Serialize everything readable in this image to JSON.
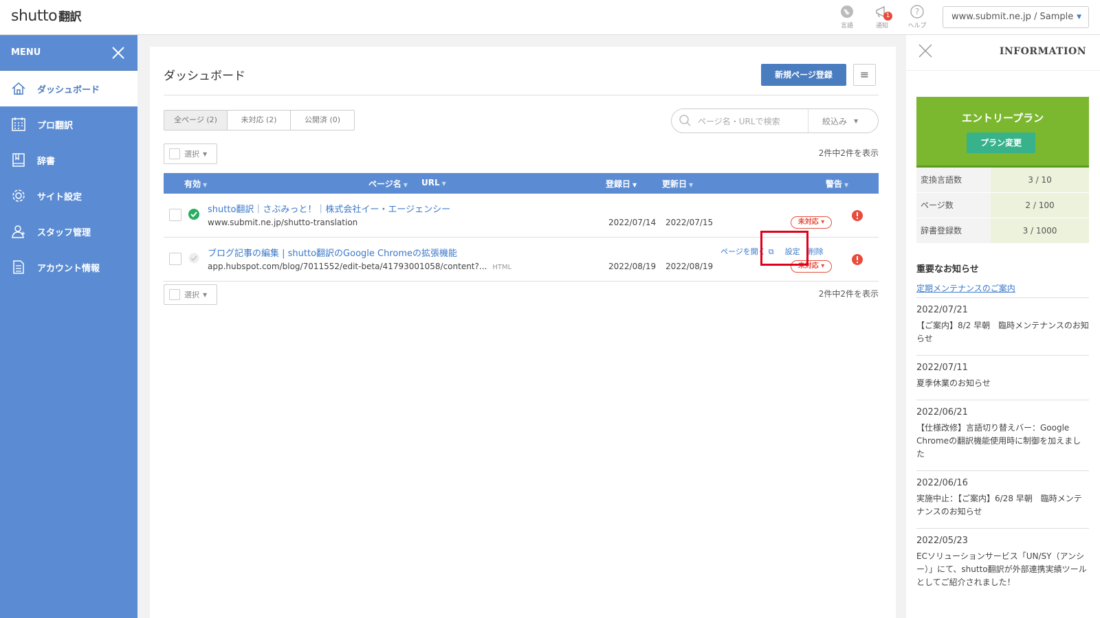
{
  "app": {
    "logo_main": "shutto",
    "logo_sub": "翻訳"
  },
  "topbar": {
    "icons": [
      {
        "name": "language",
        "caption": "言語"
      },
      {
        "name": "notifications",
        "caption": "通知",
        "badge": "1"
      },
      {
        "name": "help",
        "caption": "ヘルプ"
      }
    ],
    "site_select": "www.submit.ne.jp / Sample"
  },
  "sidebar": {
    "menu_label": "MENU",
    "items": [
      {
        "label": "ダッシュボード",
        "icon": "home-icon",
        "active": true
      },
      {
        "label": "プロ翻訳",
        "icon": "calendar-icon"
      },
      {
        "label": "辞書",
        "icon": "book-icon"
      },
      {
        "label": "サイト設定",
        "icon": "gear-icon"
      },
      {
        "label": "スタッフ管理",
        "icon": "staff-icon"
      },
      {
        "label": "アカウント情報",
        "icon": "document-icon"
      }
    ]
  },
  "main": {
    "title": "ダッシュボード",
    "new_page_button": "新規ページ登録",
    "filter_tabs": [
      "全ページ (2)",
      "未対応 (2)",
      "公開済 (0)"
    ],
    "search_placeholder": "ページ名・URLで検索",
    "narrow_label": "絞込み",
    "select_label": "選択",
    "count_text": "2件中2件を表示",
    "columns": {
      "enabled": "有効",
      "page_name": "ページ名",
      "url": "URL",
      "registered": "登録日",
      "updated": "更新日",
      "warning": "警告"
    },
    "rows": [
      {
        "title": "shutto翻訳｜さぶみっと！｜株式会社イー・エージェンシー",
        "url": "www.submit.ne.jp/shutto-translation",
        "registered": "2022/07/14",
        "updated": "2022/07/15",
        "status_pill": "未対応",
        "enabled": true
      },
      {
        "title": "ブログ記事の編集 | shutto翻訳のGoogle Chromeの拡張機能",
        "url": "app.hubspot.com/blog/7011552/edit-beta/41793001058/content?...",
        "tag": "HTML",
        "registered": "2022/08/19",
        "updated": "2022/08/19",
        "status_pill": "未対応",
        "enabled": false,
        "actions": [
          "ページを開く",
          "設定",
          "削除"
        ]
      }
    ]
  },
  "info": {
    "title": "INFORMATION",
    "plan_name": "エントリープラン",
    "plan_change": "プラン変更",
    "usage": [
      {
        "label": "変換言語数",
        "value": "3 / 10"
      },
      {
        "label": "ページ数",
        "value": "2 / 100"
      },
      {
        "label": "辞書登録数",
        "value": "3 / 1000"
      }
    ],
    "notice_title": "重要なお知らせ",
    "notice_link": "定期メンテナンスのご案内",
    "news": [
      {
        "date": "2022/07/21",
        "text": "【ご案内】8/2 早朝　臨時メンテナンスのお知らせ"
      },
      {
        "date": "2022/07/11",
        "text": "夏季休業のお知らせ"
      },
      {
        "date": "2022/06/21",
        "text": "【仕様改修】言語切り替えバー：Google Chromeの翻訳機能使用時に制御を加えました"
      },
      {
        "date": "2022/06/16",
        "text": "実施中止：【ご案内】6/28 早朝　臨時メンテナンスのお知らせ"
      },
      {
        "date": "2022/05/23",
        "text": "ECソリューションサービス「UN/SY（アンシー）」にて、shutto翻訳が外部連携実績ツールとしてご紹介されました！"
      }
    ]
  },
  "colors": {
    "primary": "#5b8cd3",
    "plan_green": "#7cb82f",
    "alert_red": "#e74c3c"
  }
}
